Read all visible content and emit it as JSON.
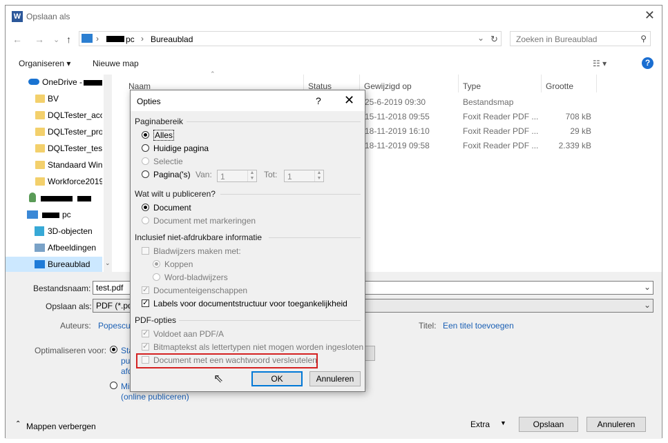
{
  "window": {
    "title": "Opslaan als",
    "icon": "word-icon",
    "close": "✕"
  },
  "nav": {
    "back": "←",
    "forward": "→",
    "recent": "⌄",
    "up": "↑",
    "path": [
      "pc",
      "Bureaublad"
    ],
    "refresh": "↻",
    "search_placeholder": "Zoeken in Bureaublad"
  },
  "toolbar": {
    "organise": "Organiseren ▾",
    "new_folder": "Nieuwe map",
    "view": "☷ ▾",
    "help": "?"
  },
  "sidebar": {
    "items": [
      {
        "label": "OneDrive -",
        "icon": "onedrive-icon"
      },
      {
        "label": "BV",
        "icon": "folder-icon"
      },
      {
        "label": "DQLTester_acce",
        "icon": "folder-icon"
      },
      {
        "label": "DQLTester_proc",
        "icon": "folder-icon"
      },
      {
        "label": "DQLTester_test",
        "icon": "folder-icon"
      },
      {
        "label": "Standaard Win",
        "icon": "folder-icon"
      },
      {
        "label": "Workforce2019",
        "icon": "folder-icon"
      },
      {
        "label": "",
        "icon": "user-icon"
      },
      {
        "label": "pc",
        "icon": "computer-icon"
      },
      {
        "label": "3D-objecten",
        "icon": "cube-icon"
      },
      {
        "label": "Afbeeldingen",
        "icon": "pictures-icon"
      },
      {
        "label": "Bureaublad",
        "icon": "desktop-icon"
      }
    ]
  },
  "columns": [
    "Naam",
    "Status",
    "Gewijzigd op",
    "Type",
    "Grootte"
  ],
  "rows": [
    {
      "date": "25-6-2019 09:30",
      "type": "Bestandsmap",
      "size": ""
    },
    {
      "date": "15-11-2018 09:55",
      "type": "Foxit Reader PDF ...",
      "size": "708 kB"
    },
    {
      "date": "18-11-2019 16:10",
      "type": "Foxit Reader PDF ...",
      "size": "29 kB"
    },
    {
      "date": "18-11-2019 09:58",
      "type": "Foxit Reader PDF ...",
      "size": "2.339 kB"
    }
  ],
  "form": {
    "filename_label": "Bestandsnaam:",
    "filename_value": "test.pdf",
    "savetype_label": "Opslaan als:",
    "savetype_value": "PDF (*.pdf",
    "authors_label": "Auteurs:",
    "authors_value": "Popescu,",
    "title_label": "Titel:",
    "title_value": "Een titel toevoegen",
    "optimize_label": "Optimaliseren voor:",
    "opt1_lines": [
      "Sta",
      "pu",
      "afd"
    ],
    "opt2_lines": [
      "Mi",
      "(online publiceren)"
    ]
  },
  "footer": {
    "hide_folders": "Mappen verbergen",
    "extra": "Extra",
    "save": "Opslaan",
    "cancel": "Annuleren"
  },
  "dialog": {
    "title": "Opties",
    "help": "?",
    "close": "✕",
    "page_range": {
      "heading": "Paginabereik",
      "all": "Alles",
      "current": "Huidige pagina",
      "selection": "Selectie",
      "pages": "Pagina('s)",
      "from_label": "Van:",
      "from_value": "1",
      "to_label": "Tot:",
      "to_value": "1"
    },
    "publish": {
      "heading": "Wat wilt u publiceren?",
      "document": "Document",
      "markup": "Document met markeringen"
    },
    "nonprint": {
      "heading": "Inclusief niet-afdrukbare informatie",
      "bookmarks": "Bladwijzers maken met:",
      "headings": "Koppen",
      "word_bookmarks": "Word-bladwijzers",
      "properties": "Documenteigenschappen",
      "structure_tags": "Labels voor documentstructuur voor toegankelijkheid"
    },
    "pdf": {
      "heading": "PDF-opties",
      "pdfa": "Voldoet aan PDF/A",
      "bitmap": "Bitmaptekst als lettertypen niet mogen worden ingesloten",
      "encrypt": "Document met een wachtwoord versleutelen"
    },
    "ok": "OK",
    "cancel": "Annuleren"
  }
}
